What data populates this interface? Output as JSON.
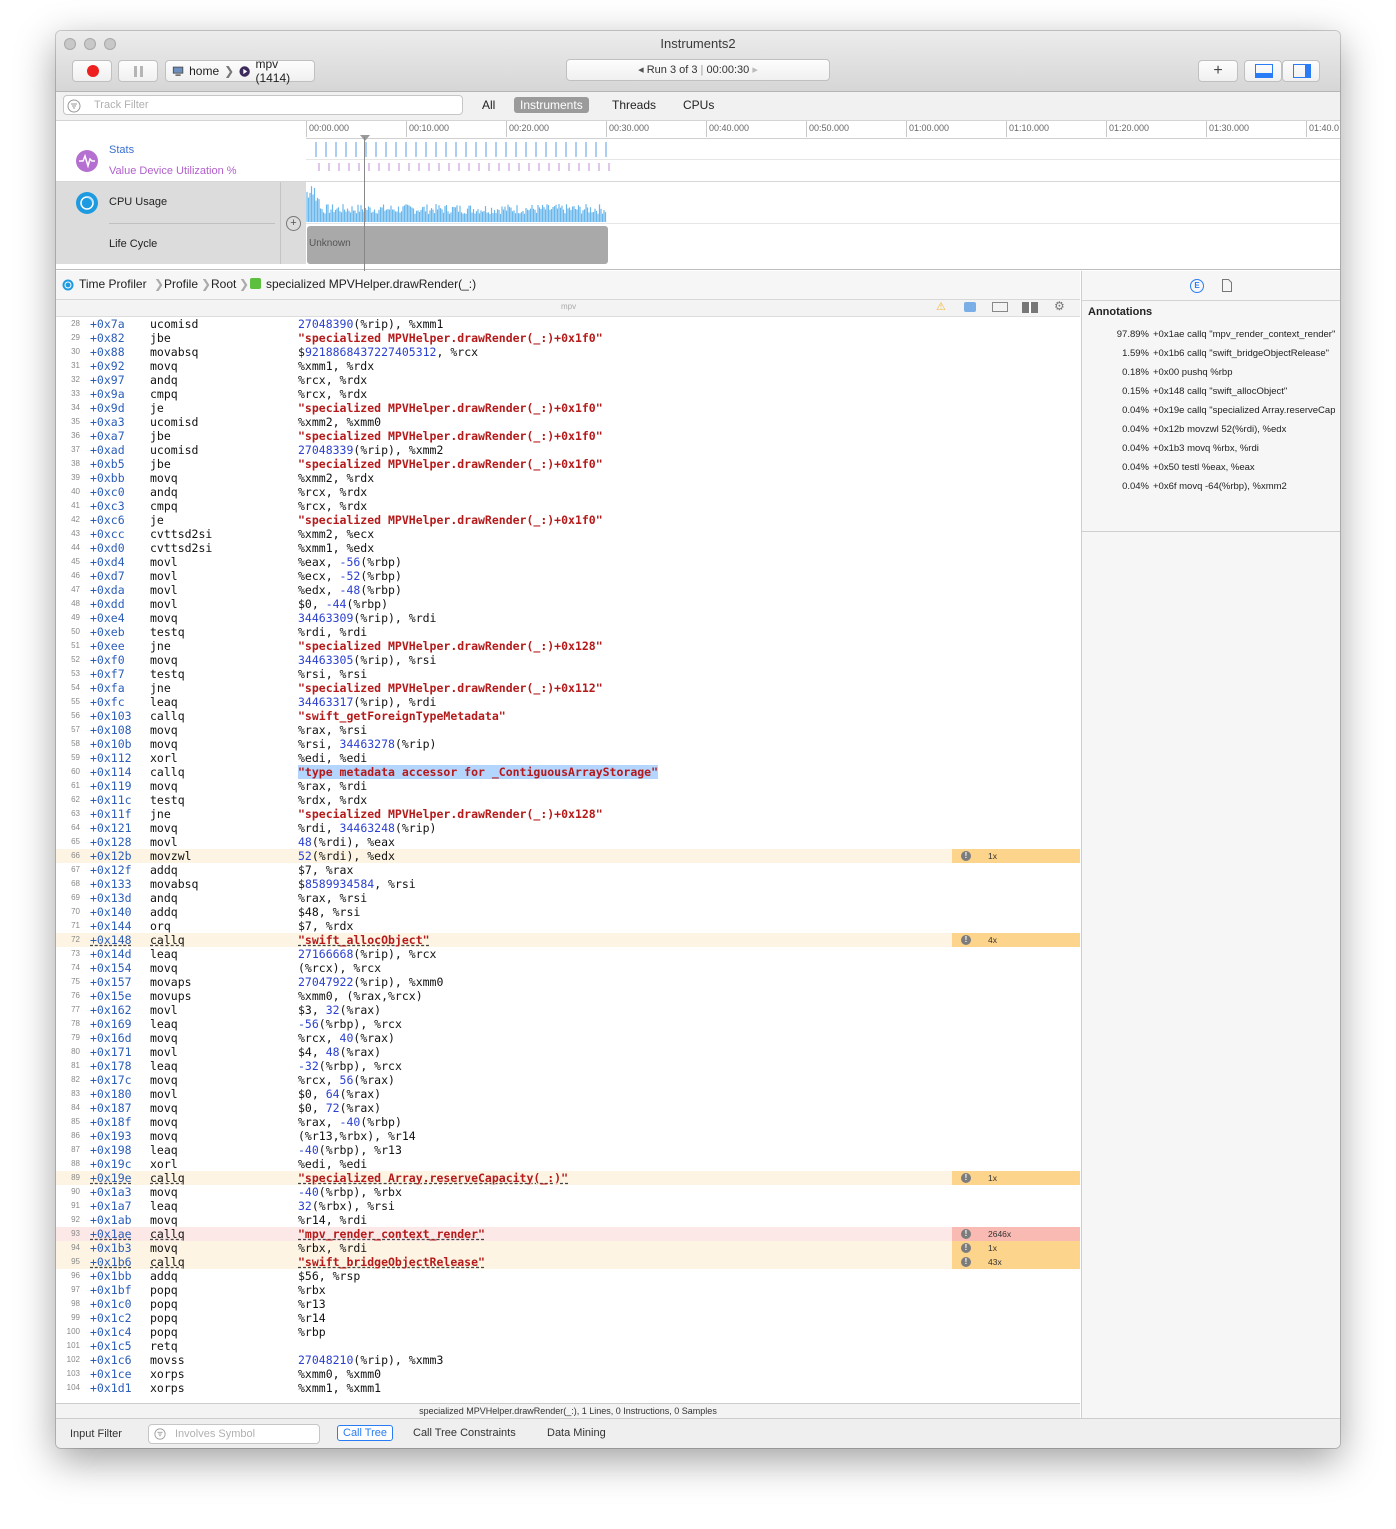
{
  "window": {
    "title": "Instruments2"
  },
  "toolbar": {
    "target_host": "home",
    "target_process": "mpv (1414)",
    "run_label": "Run 3 of 3",
    "run_time": "00:00:30"
  },
  "filter": {
    "placeholder": "Track Filter",
    "tabs": [
      "All",
      "Instruments",
      "Threads",
      "CPUs"
    ],
    "selected_tab": "Instruments"
  },
  "timeline": {
    "ticks": [
      "00:00.000",
      "00:10.000",
      "00:20.000",
      "00:30.000",
      "00:40.000",
      "00:50.000",
      "01:00.000",
      "01:10.000",
      "01:20.000",
      "01:30.000",
      "01:40.0"
    ],
    "tracks": {
      "stats": "Stats",
      "value": "Value Device Utilization %",
      "cpu": "CPU Usage",
      "lifecycle": "Life Cycle",
      "lifecycle_state": "Unknown"
    }
  },
  "breadcrumb": [
    "Time Profiler",
    "Profile",
    "Root",
    "specialized MPVHelper.drawRender(_:)"
  ],
  "code_header": {
    "module": "mpv"
  },
  "code_rows": [
    {
      "n": "28",
      "a": "+0x7a",
      "o": "ucomisd",
      "g": [
        [
          "n",
          "27048390"
        ],
        [
          "t",
          "(%rip), %xmm1"
        ]
      ]
    },
    {
      "n": "29",
      "a": "+0x82",
      "o": "jbe",
      "g": [
        [
          "k",
          "\"specialized MPVHelper.drawRender(_:)+0x1f0\""
        ]
      ]
    },
    {
      "n": "30",
      "a": "+0x88",
      "o": "movabsq",
      "g": [
        [
          "t",
          "$"
        ],
        [
          "n",
          "9218868437227405312"
        ],
        [
          "t",
          ", %rcx"
        ]
      ]
    },
    {
      "n": "31",
      "a": "+0x92",
      "o": "movq",
      "g": [
        [
          "t",
          "%xmm1, %rdx"
        ]
      ]
    },
    {
      "n": "32",
      "a": "+0x97",
      "o": "andq",
      "g": [
        [
          "t",
          "%rcx, %rdx"
        ]
      ]
    },
    {
      "n": "33",
      "a": "+0x9a",
      "o": "cmpq",
      "g": [
        [
          "t",
          "%rcx, %rdx"
        ]
      ]
    },
    {
      "n": "34",
      "a": "+0x9d",
      "o": "je",
      "g": [
        [
          "k",
          "\"specialized MPVHelper.drawRender(_:)+0x1f0\""
        ]
      ]
    },
    {
      "n": "35",
      "a": "+0xa3",
      "o": "ucomisd",
      "g": [
        [
          "t",
          "%xmm2, %xmm0"
        ]
      ]
    },
    {
      "n": "36",
      "a": "+0xa7",
      "o": "jbe",
      "g": [
        [
          "k",
          "\"specialized MPVHelper.drawRender(_:)+0x1f0\""
        ]
      ]
    },
    {
      "n": "37",
      "a": "+0xad",
      "o": "ucomisd",
      "g": [
        [
          "n",
          "27048339"
        ],
        [
          "t",
          "(%rip), %xmm2"
        ]
      ]
    },
    {
      "n": "38",
      "a": "+0xb5",
      "o": "jbe",
      "g": [
        [
          "k",
          "\"specialized MPVHelper.drawRender(_:)+0x1f0\""
        ]
      ]
    },
    {
      "n": "39",
      "a": "+0xbb",
      "o": "movq",
      "g": [
        [
          "t",
          "%xmm2, %rdx"
        ]
      ]
    },
    {
      "n": "40",
      "a": "+0xc0",
      "o": "andq",
      "g": [
        [
          "t",
          "%rcx, %rdx"
        ]
      ]
    },
    {
      "n": "41",
      "a": "+0xc3",
      "o": "cmpq",
      "g": [
        [
          "t",
          "%rcx, %rdx"
        ]
      ]
    },
    {
      "n": "42",
      "a": "+0xc6",
      "o": "je",
      "g": [
        [
          "k",
          "\"specialized MPVHelper.drawRender(_:)+0x1f0\""
        ]
      ]
    },
    {
      "n": "43",
      "a": "+0xcc",
      "o": "cvttsd2si",
      "g": [
        [
          "t",
          "%xmm2, %ecx"
        ]
      ]
    },
    {
      "n": "44",
      "a": "+0xd0",
      "o": "cvttsd2si",
      "g": [
        [
          "t",
          "%xmm1, %edx"
        ]
      ]
    },
    {
      "n": "45",
      "a": "+0xd4",
      "o": "movl",
      "g": [
        [
          "t",
          "%eax, "
        ],
        [
          "n",
          "-56"
        ],
        [
          "t",
          "(%rbp)"
        ]
      ]
    },
    {
      "n": "46",
      "a": "+0xd7",
      "o": "movl",
      "g": [
        [
          "t",
          "%ecx, "
        ],
        [
          "n",
          "-52"
        ],
        [
          "t",
          "(%rbp)"
        ]
      ]
    },
    {
      "n": "47",
      "a": "+0xda",
      "o": "movl",
      "g": [
        [
          "t",
          "%edx, "
        ],
        [
          "n",
          "-48"
        ],
        [
          "t",
          "(%rbp)"
        ]
      ]
    },
    {
      "n": "48",
      "a": "+0xdd",
      "o": "movl",
      "g": [
        [
          "t",
          "$0, "
        ],
        [
          "n",
          "-44"
        ],
        [
          "t",
          "(%rbp)"
        ]
      ]
    },
    {
      "n": "49",
      "a": "+0xe4",
      "o": "movq",
      "g": [
        [
          "n",
          "34463309"
        ],
        [
          "t",
          "(%rip), %rdi"
        ]
      ]
    },
    {
      "n": "50",
      "a": "+0xeb",
      "o": "testq",
      "g": [
        [
          "t",
          "%rdi, %rdi"
        ]
      ]
    },
    {
      "n": "51",
      "a": "+0xee",
      "o": "jne",
      "g": [
        [
          "k",
          "\"specialized MPVHelper.drawRender(_:)+0x128\""
        ]
      ]
    },
    {
      "n": "52",
      "a": "+0xf0",
      "o": "movq",
      "g": [
        [
          "n",
          "34463305"
        ],
        [
          "t",
          "(%rip), %rsi"
        ]
      ]
    },
    {
      "n": "53",
      "a": "+0xf7",
      "o": "testq",
      "g": [
        [
          "t",
          "%rsi, %rsi"
        ]
      ]
    },
    {
      "n": "54",
      "a": "+0xfa",
      "o": "jne",
      "g": [
        [
          "k",
          "\"specialized MPVHelper.drawRender(_:)+0x112\""
        ]
      ]
    },
    {
      "n": "55",
      "a": "+0xfc",
      "o": "leaq",
      "g": [
        [
          "n",
          "34463317"
        ],
        [
          "t",
          "(%rip), %rdi"
        ]
      ]
    },
    {
      "n": "56",
      "a": "+0x103",
      "o": "callq",
      "g": [
        [
          "k",
          "\"swift_getForeignTypeMetadata\""
        ]
      ]
    },
    {
      "n": "57",
      "a": "+0x108",
      "o": "movq",
      "g": [
        [
          "t",
          "%rax, %rsi"
        ]
      ]
    },
    {
      "n": "58",
      "a": "+0x10b",
      "o": "movq",
      "g": [
        [
          "t",
          "%rsi, "
        ],
        [
          "n",
          "34463278"
        ],
        [
          "t",
          "(%rip)"
        ]
      ]
    },
    {
      "n": "59",
      "a": "+0x112",
      "o": "xorl",
      "g": [
        [
          "t",
          "%edi, %edi"
        ]
      ]
    },
    {
      "n": "60",
      "a": "+0x114",
      "o": "callq",
      "sel": true,
      "g": [
        [
          "k",
          "\"type metadata accessor for _ContiguousArrayStorage\""
        ]
      ]
    },
    {
      "n": "61",
      "a": "+0x119",
      "o": "movq",
      "g": [
        [
          "t",
          "%rax, %rdi"
        ]
      ]
    },
    {
      "n": "62",
      "a": "+0x11c",
      "o": "testq",
      "g": [
        [
          "t",
          "%rdx, %rdx"
        ]
      ]
    },
    {
      "n": "63",
      "a": "+0x11f",
      "o": "jne",
      "g": [
        [
          "k",
          "\"specialized MPVHelper.drawRender(_:)+0x128\""
        ]
      ]
    },
    {
      "n": "64",
      "a": "+0x121",
      "o": "movq",
      "g": [
        [
          "t",
          "%rdi, "
        ],
        [
          "n",
          "34463248"
        ],
        [
          "t",
          "(%rip)"
        ]
      ]
    },
    {
      "n": "65",
      "a": "+0x128",
      "o": "movl",
      "g": [
        [
          "n",
          "48"
        ],
        [
          "t",
          "(%rdi), %eax"
        ]
      ]
    },
    {
      "n": "66",
      "a": "+0x12b",
      "o": "movzwl",
      "hl": "warm",
      "badge": "1x",
      "g": [
        [
          "n",
          "52"
        ],
        [
          "t",
          "(%rdi), %edx"
        ]
      ]
    },
    {
      "n": "67",
      "a": "+0x12f",
      "o": "addq",
      "g": [
        [
          "t",
          "$7, %rax"
        ]
      ]
    },
    {
      "n": "68",
      "a": "+0x133",
      "o": "movabsq",
      "g": [
        [
          "t",
          "$"
        ],
        [
          "n",
          "8589934584"
        ],
        [
          "t",
          ", %rsi"
        ]
      ]
    },
    {
      "n": "69",
      "a": "+0x13d",
      "o": "andq",
      "g": [
        [
          "t",
          "%rax, %rsi"
        ]
      ]
    },
    {
      "n": "70",
      "a": "+0x140",
      "o": "addq",
      "g": [
        [
          "t",
          "$48, %rsi"
        ]
      ]
    },
    {
      "n": "71",
      "a": "+0x144",
      "o": "orq",
      "g": [
        [
          "t",
          "$7, %rdx"
        ]
      ]
    },
    {
      "n": "72",
      "a": "+0x148",
      "o": "callq",
      "hl": "warm",
      "dotted": true,
      "badge": "4x",
      "g": [
        [
          "k",
          "\"swift_allocObject\""
        ]
      ]
    },
    {
      "n": "73",
      "a": "+0x14d",
      "o": "leaq",
      "g": [
        [
          "n",
          "27166668"
        ],
        [
          "t",
          "(%rip), %rcx"
        ]
      ]
    },
    {
      "n": "74",
      "a": "+0x154",
      "o": "movq",
      "g": [
        [
          "t",
          "(%rcx), %rcx"
        ]
      ]
    },
    {
      "n": "75",
      "a": "+0x157",
      "o": "movaps",
      "g": [
        [
          "n",
          "27047922"
        ],
        [
          "t",
          "(%rip), %xmm0"
        ]
      ]
    },
    {
      "n": "76",
      "a": "+0x15e",
      "o": "movups",
      "g": [
        [
          "t",
          "%xmm0, (%rax,%rcx)"
        ]
      ]
    },
    {
      "n": "77",
      "a": "+0x162",
      "o": "movl",
      "g": [
        [
          "t",
          "$3, "
        ],
        [
          "n",
          "32"
        ],
        [
          "t",
          "(%rax)"
        ]
      ]
    },
    {
      "n": "78",
      "a": "+0x169",
      "o": "leaq",
      "g": [
        [
          "n",
          "-56"
        ],
        [
          "t",
          "(%rbp), %rcx"
        ]
      ]
    },
    {
      "n": "79",
      "a": "+0x16d",
      "o": "movq",
      "g": [
        [
          "t",
          "%rcx, "
        ],
        [
          "n",
          "40"
        ],
        [
          "t",
          "(%rax)"
        ]
      ]
    },
    {
      "n": "80",
      "a": "+0x171",
      "o": "movl",
      "g": [
        [
          "t",
          "$4, "
        ],
        [
          "n",
          "48"
        ],
        [
          "t",
          "(%rax)"
        ]
      ]
    },
    {
      "n": "81",
      "a": "+0x178",
      "o": "leaq",
      "g": [
        [
          "n",
          "-32"
        ],
        [
          "t",
          "(%rbp), %rcx"
        ]
      ]
    },
    {
      "n": "82",
      "a": "+0x17c",
      "o": "movq",
      "g": [
        [
          "t",
          "%rcx, "
        ],
        [
          "n",
          "56"
        ],
        [
          "t",
          "(%rax)"
        ]
      ]
    },
    {
      "n": "83",
      "a": "+0x180",
      "o": "movl",
      "g": [
        [
          "t",
          "$0, "
        ],
        [
          "n",
          "64"
        ],
        [
          "t",
          "(%rax)"
        ]
      ]
    },
    {
      "n": "84",
      "a": "+0x187",
      "o": "movq",
      "g": [
        [
          "t",
          "$0, "
        ],
        [
          "n",
          "72"
        ],
        [
          "t",
          "(%rax)"
        ]
      ]
    },
    {
      "n": "85",
      "a": "+0x18f",
      "o": "movq",
      "g": [
        [
          "t",
          "%rax, "
        ],
        [
          "n",
          "-40"
        ],
        [
          "t",
          "(%rbp)"
        ]
      ]
    },
    {
      "n": "86",
      "a": "+0x193",
      "o": "movq",
      "g": [
        [
          "t",
          "(%r13,%rbx), %r14"
        ]
      ]
    },
    {
      "n": "87",
      "a": "+0x198",
      "o": "leaq",
      "g": [
        [
          "n",
          "-40"
        ],
        [
          "t",
          "(%rbp), %r13"
        ]
      ]
    },
    {
      "n": "88",
      "a": "+0x19c",
      "o": "xorl",
      "g": [
        [
          "t",
          "%edi, %edi"
        ]
      ]
    },
    {
      "n": "89",
      "a": "+0x19e",
      "o": "callq",
      "hl": "warm",
      "dotted": true,
      "badge": "1x",
      "g": [
        [
          "k",
          "\"specialized Array.reserveCapacity(_:)\""
        ]
      ]
    },
    {
      "n": "90",
      "a": "+0x1a3",
      "o": "movq",
      "g": [
        [
          "n",
          "-40"
        ],
        [
          "t",
          "(%rbp), %rbx"
        ]
      ]
    },
    {
      "n": "91",
      "a": "+0x1a7",
      "o": "leaq",
      "g": [
        [
          "n",
          "32"
        ],
        [
          "t",
          "(%rbx), %rsi"
        ]
      ]
    },
    {
      "n": "92",
      "a": "+0x1ab",
      "o": "movq",
      "g": [
        [
          "t",
          "%r14, %rdi"
        ]
      ]
    },
    {
      "n": "93",
      "a": "+0x1ae",
      "o": "callq",
      "hl": "hot",
      "dotted": true,
      "badge": "2646x",
      "g": [
        [
          "k",
          "\"mpv_render_context_render\""
        ]
      ]
    },
    {
      "n": "94",
      "a": "+0x1b3",
      "o": "movq",
      "hl": "warm",
      "badge": "1x",
      "g": [
        [
          "t",
          "%rbx, %rdi"
        ]
      ]
    },
    {
      "n": "95",
      "a": "+0x1b6",
      "o": "callq",
      "hl": "warm",
      "dotted": true,
      "badge": "43x",
      "g": [
        [
          "k",
          "\"swift_bridgeObjectRelease\""
        ]
      ]
    },
    {
      "n": "96",
      "a": "+0x1bb",
      "o": "addq",
      "g": [
        [
          "t",
          "$56, %rsp"
        ]
      ]
    },
    {
      "n": "97",
      "a": "+0x1bf",
      "o": "popq",
      "g": [
        [
          "t",
          "%rbx"
        ]
      ]
    },
    {
      "n": "98",
      "a": "+0x1c0",
      "o": "popq",
      "g": [
        [
          "t",
          "%r13"
        ]
      ]
    },
    {
      "n": "99",
      "a": "+0x1c2",
      "o": "popq",
      "g": [
        [
          "t",
          "%r14"
        ]
      ]
    },
    {
      "n": "100",
      "a": "+0x1c4",
      "o": "popq",
      "g": [
        [
          "t",
          "%rbp"
        ]
      ]
    },
    {
      "n": "101",
      "a": "+0x1c5",
      "o": "retq",
      "g": []
    },
    {
      "n": "102",
      "a": "+0x1c6",
      "o": "movss",
      "g": [
        [
          "n",
          "27048210"
        ],
        [
          "t",
          "(%rip), %xmm3"
        ]
      ]
    },
    {
      "n": "103",
      "a": "+0x1ce",
      "o": "xorps",
      "g": [
        [
          "t",
          "%xmm0, %xmm0"
        ]
      ]
    },
    {
      "n": "104",
      "a": "+0x1d1",
      "o": "xorps",
      "g": [
        [
          "t",
          "%xmm1, %xmm1"
        ]
      ]
    }
  ],
  "status_line": "specialized MPVHelper.drawRender(_:), 1 Lines, 0 Instructions, 0 Samples",
  "bottom": {
    "input_filter": "Input Filter",
    "search_placeholder": "Involves Symbol",
    "tabs": [
      "Call Tree",
      "Call Tree Constraints",
      "Data Mining"
    ],
    "selected_tab": "Call Tree"
  },
  "annotations": {
    "title": "Annotations",
    "rows": [
      {
        "pct": "97.89%",
        "text": "+0x1ae callq \"mpv_render_context_render\""
      },
      {
        "pct": "1.59%",
        "text": "+0x1b6 callq \"swift_bridgeObjectRelease\""
      },
      {
        "pct": "0.18%",
        "text": "+0x00 pushq %rbp"
      },
      {
        "pct": "0.15%",
        "text": "+0x148 callq \"swift_allocObject\""
      },
      {
        "pct": "0.04%",
        "text": "+0x19e callq \"specialized Array.reserveCapacity(_:)\""
      },
      {
        "pct": "0.04%",
        "text": "+0x12b movzwl 52(%rdi), %edx"
      },
      {
        "pct": "0.04%",
        "text": "+0x1b3 movq %rbx, %rdi"
      },
      {
        "pct": "0.04%",
        "text": "+0x50 testl %eax, %eax"
      },
      {
        "pct": "0.04%",
        "text": "+0x6f movq -64(%rbp), %xmm2"
      }
    ]
  },
  "colors": {
    "accent": "#2a7cf6",
    "record": "#ee1f1f",
    "cpu_bar": "#6ab7ec",
    "stats_bar": "#5a9de6",
    "value_bar": "#c58bd6",
    "hot_row": "#f8bab2",
    "warm_row": "#fcd48b",
    "code_keyword": "#b51a1a",
    "code_number": "#2a3fd0",
    "code_addr": "#2a5cb8"
  }
}
